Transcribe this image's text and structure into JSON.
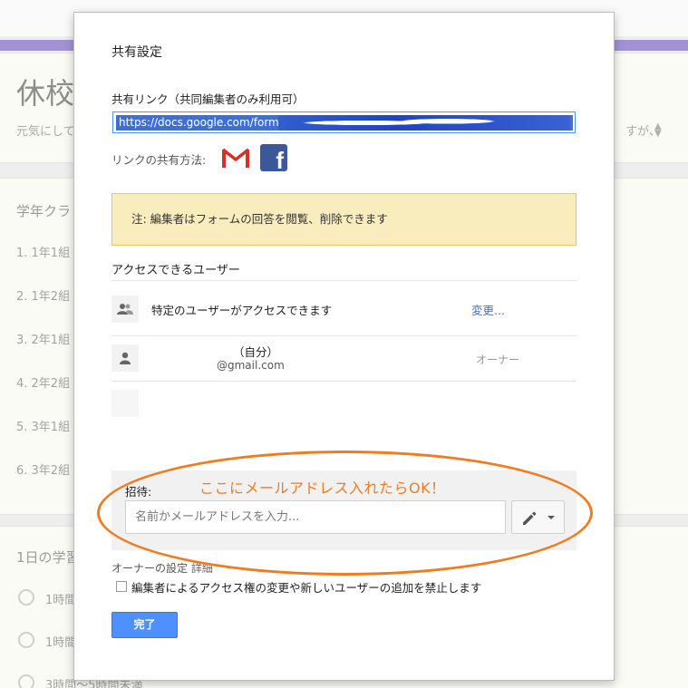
{
  "background": {
    "title": "休校",
    "subtitle": "元気にして",
    "subtitle_right": "すが、",
    "section_title": "学年クラ",
    "list_items": [
      "1.  1年1組",
      "2.  1年2組",
      "3.  2年1組",
      "4.  2年2組",
      "5.  3年1組",
      "6.  3年2組"
    ],
    "question_title": "1日の学習",
    "radio_options": [
      "1時間",
      "1時間",
      "3時間〜5時間未満"
    ]
  },
  "dialog": {
    "title": "共有設定",
    "link_label": "共有リンク（共同編集者のみ利用可）",
    "link_value": "https://docs.google.com/forms/",
    "share_via_label": "リンクの共有方法:",
    "share_icons": [
      "gmail-icon",
      "facebook-icon"
    ],
    "note": "注: 編集者はフォームの回答を閲覧、削除できます",
    "access_title": "アクセスできるユーザー",
    "access_mode": "特定のユーザーがアクセスできます",
    "change_link": "変更...",
    "owner_name": "（自分）",
    "owner_email": "@gmail.com",
    "owner_role": "オーナー",
    "invite_label": "招待:",
    "invite_placeholder": "名前かメールアドレスを入力...",
    "owner_settings_label": "オーナーの設定",
    "owner_settings_detail": "詳細",
    "restrict_label": "編集者によるアクセス権の変更や新しいユーザーの追加を禁止します",
    "done_button": "完了"
  },
  "annotation": {
    "text": "ここにメールアドレス入れたらOK！",
    "color": "#f07c22"
  },
  "colors": {
    "accent_blue": "#4d90fe",
    "facebook": "#3b5998",
    "gmail_red": "#d93025",
    "note_bg": "#f9edbe",
    "header_purple": "#a391d6"
  }
}
